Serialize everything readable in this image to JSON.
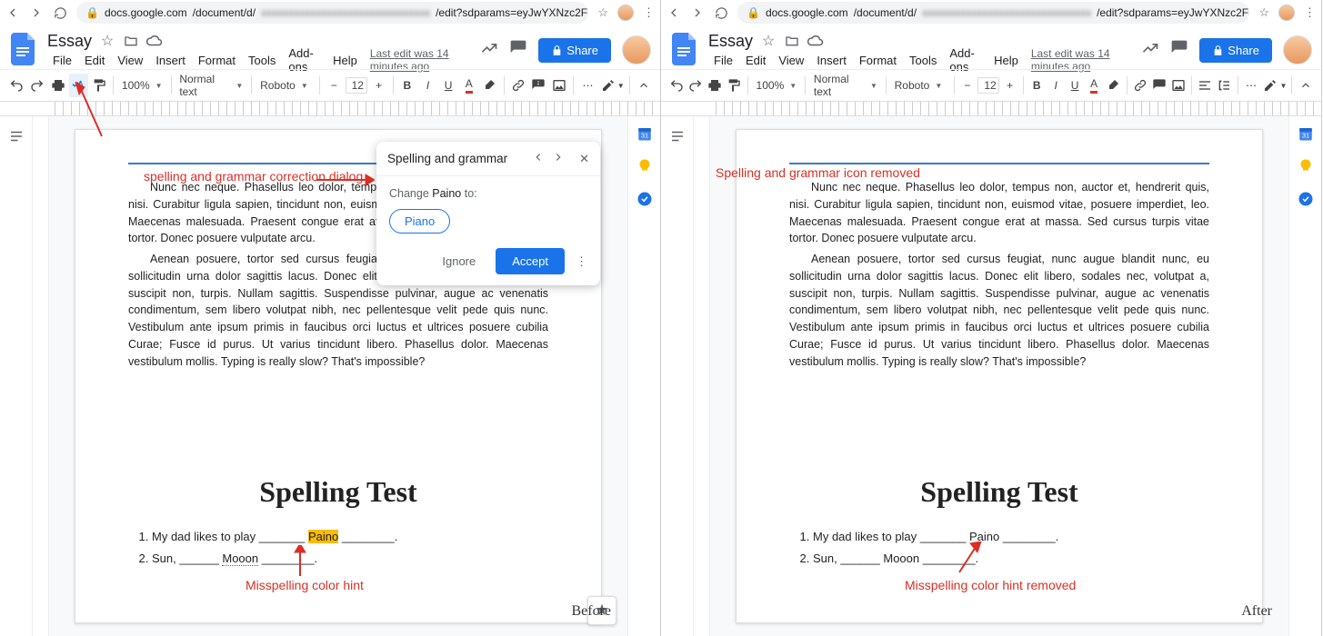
{
  "url": {
    "host": "docs.google.com",
    "path_prefix": "/document/d/",
    "path_blur": "xxxxxxxxxxxxxxxxxxxxxxxxxxxxxxx",
    "path_suffix": "/edit?sdparams=eyJwYXNzc2FmZWRvY…"
  },
  "doc": {
    "title": "Essay",
    "last_edit": "Last edit was 14 minutes ago"
  },
  "menus": [
    "File",
    "Edit",
    "View",
    "Insert",
    "Format",
    "Tools",
    "Add-ons",
    "Help"
  ],
  "share": "Share",
  "toolbar": {
    "zoom": "100%",
    "style": "Normal text",
    "font": "Roboto",
    "size": "12"
  },
  "page": {
    "para1": "Nunc nec neque. Phasellus leo dolor, tempus non, auctor et, hendrerit quis, nisi. Curabitur ligula sapien, tincidunt non, euismod vitae, posuere imperdiet, leo. Maecenas malesuada. Praesent congue erat at massa. Sed cursus turpis vitae tortor. Donec posuere vulputate arcu.",
    "para2": "Aenean posuere, tortor sed cursus feugiat, nunc augue blandit nunc, eu sollicitudin urna dolor sagittis lacus. Donec elit libero, sodales nec, volutpat a, suscipit non, turpis. Nullam sagittis. Suspendisse pulvinar, augue ac venenatis condimentum, sem libero volutpat nibh, nec pellentesque velit pede quis nunc. Vestibulum ante ipsum primis in faucibus orci luctus et ultrices posuere cubilia Curae; Fusce id purus. Ut varius tincidunt libero. Phasellus dolor. Maecenas vestibulum mollis. Typing is really slow? That's impossible?",
    "heading": "Spelling Test",
    "item1_pre": "My dad likes to play _______ ",
    "item1_word": "Paino",
    "item1_post": " ________.",
    "item2_pre": "Sun, ______ ",
    "item2_word": "Mooon",
    "item2_post": " ________."
  },
  "popup": {
    "title": "Spelling and grammar",
    "change_prefix": "Change ",
    "change_word": "Paino",
    "change_suffix": " to:",
    "suggestion": "Piano",
    "ignore": "Ignore",
    "accept": "Accept"
  },
  "anno": {
    "dialog_label": "spelling and grammar correction dialog",
    "icon_removed": "Spelling and grammar icon removed",
    "misspelling_hint": "Misspelling color hint",
    "misspelling_removed": "Misspelling color hint removed",
    "before": "Before",
    "after": "After"
  }
}
